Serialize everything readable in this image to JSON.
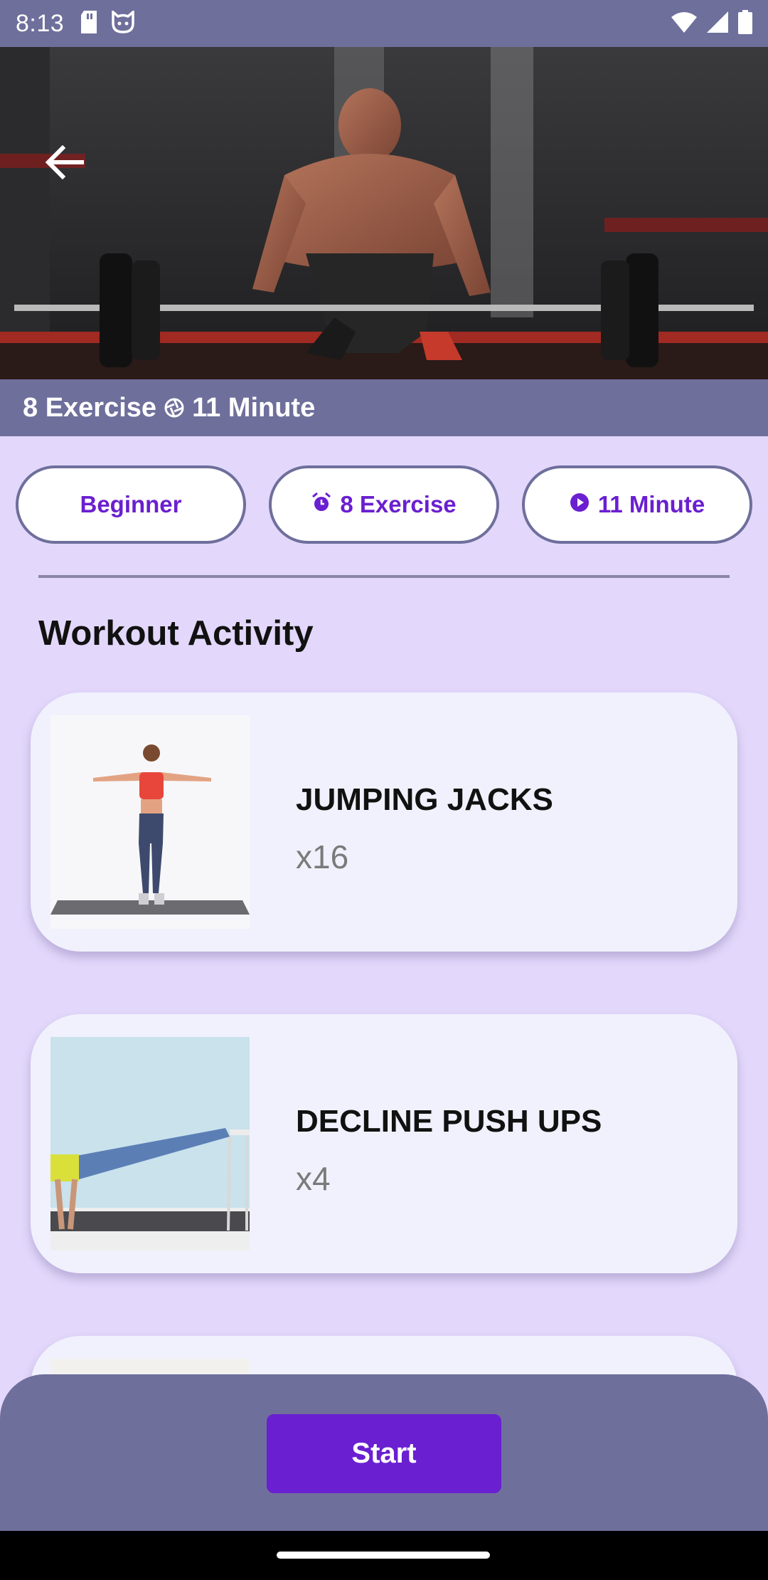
{
  "status_bar": {
    "time": "8:13",
    "icons": [
      "sd-card-icon",
      "cat-face-icon",
      "wifi-icon",
      "cellular-signal-icon",
      "battery-icon"
    ]
  },
  "hero": {
    "image": "man-deadlift-barbell-photo",
    "back_icon": "arrow-left-icon"
  },
  "info_strip": {
    "exercises": "8 Exercise",
    "separator_icon": "shutter-icon",
    "duration": "11 Minute"
  },
  "chips": [
    {
      "label": "Beginner",
      "icon": null
    },
    {
      "label": "8 Exercise",
      "icon": "alarm-icon"
    },
    {
      "label": "11 Minute",
      "icon": "play-circle-icon"
    }
  ],
  "section_title": "Workout Activity",
  "exercises": [
    {
      "name": "JUMPING JACKS",
      "reps": "x16",
      "image": "woman-jumping-jacks-photo"
    },
    {
      "name": "DECLINE PUSH UPS",
      "reps": "x4",
      "image": "woman-decline-push-up-photo"
    }
  ],
  "start_label": "Start",
  "colors": {
    "background": "#e3d8fb",
    "bar": "#6f6f9c",
    "accent": "#6a1fd0",
    "card": "#f1f1fd"
  }
}
